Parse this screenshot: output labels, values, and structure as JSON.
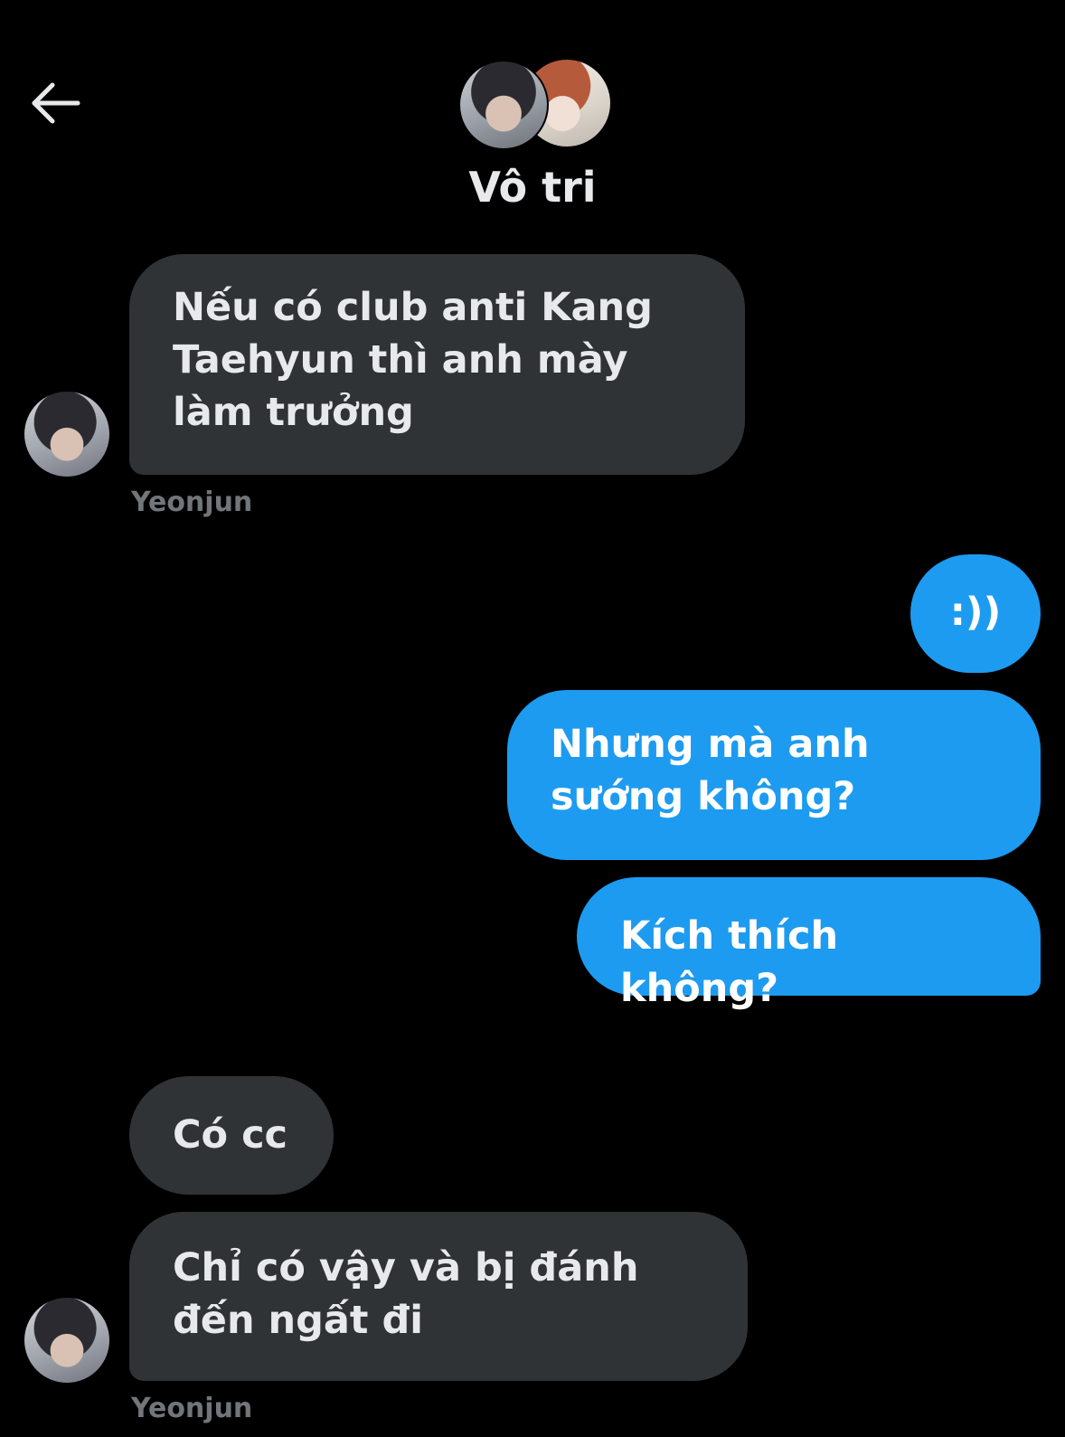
{
  "header": {
    "title": "Vô tri",
    "back_icon": "arrow-left-icon"
  },
  "messages": [
    {
      "side": "incoming",
      "text": "Nếu có club anti Kang Taehyun thì anh mày làm trưởng",
      "sender": "Yeonjun"
    },
    {
      "side": "outgoing",
      "text": ":))"
    },
    {
      "side": "outgoing",
      "text": "Nhưng mà anh sướng không?"
    },
    {
      "side": "outgoing",
      "text": "Kích thích không?"
    },
    {
      "side": "incoming",
      "text": "Có cc"
    },
    {
      "side": "incoming",
      "text": "Chỉ có vậy và bị đánh đến ngất đi",
      "sender": "Yeonjun"
    }
  ],
  "colors": {
    "background": "#000000",
    "incoming_bubble": "#2f3336",
    "outgoing_bubble": "#1d9bf0",
    "sender_name": "#71767b",
    "text": "#e7e9ea"
  }
}
